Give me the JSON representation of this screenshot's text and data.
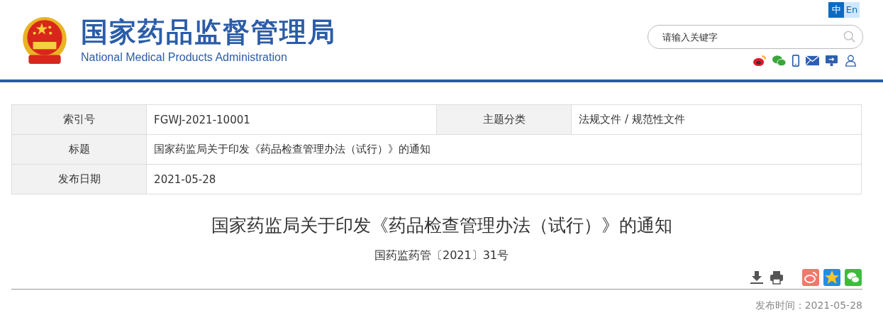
{
  "header": {
    "title": "国家药品监督管理局",
    "subtitle": "National Medical Products Administration",
    "languages": [
      {
        "label": "中",
        "selected": true
      },
      {
        "label": "En",
        "selected": false
      }
    ],
    "search": {
      "placeholder": "请输入关键字"
    }
  },
  "meta": [
    {
      "fields": [
        {
          "label": "索引号",
          "value": "FGWJ-2021-10001"
        },
        {
          "label": "主题分类",
          "value": "法规文件 / 规范性文件"
        }
      ]
    },
    {
      "fields": [
        {
          "label": "标题",
          "value": "国家药监局关于印发《药品检查管理办法（试行）》的通知"
        }
      ]
    },
    {
      "fields": [
        {
          "label": "发布日期",
          "value": "2021-05-28"
        }
      ]
    }
  ],
  "article": {
    "title": "国家药监局关于印发《药品检查管理办法（试行）》的通知",
    "doc_number": "国药监药管〔2021〕31号",
    "publish_time": "发布时间：2021-05-28"
  }
}
